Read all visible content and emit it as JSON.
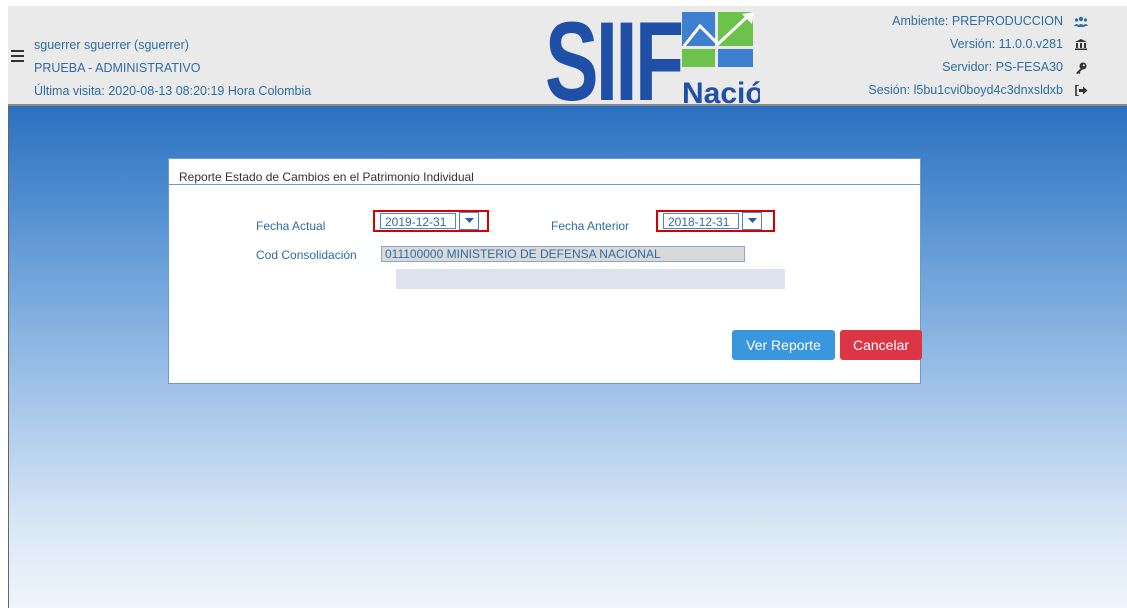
{
  "header": {
    "user_name": "sguerrer sguerrer (sguerrer)",
    "profile": "PRUEBA - ADMINISTRATIVO",
    "last_visit": "Última visita: 2020-08-13 08:20:19 Hora Colombia",
    "logo": {
      "main_text": "SIIF",
      "sub_text": "Nación",
      "brand_color": "#1f4fa6",
      "accent_color": "#6cc24a"
    },
    "environment": "Ambiente: PREPRODUCCION",
    "version": "Versión: 11.0.0.v281",
    "server": "Servidor: PS-FESA30",
    "session": "Sesión: l5bu1cvi0boyd4c3dnxsldxb",
    "icons": [
      "users-icon",
      "bank-icon",
      "key-icon",
      "logout-icon",
      "menu-icon"
    ]
  },
  "panel": {
    "title": "Reporte Estado de Cambios en el Patrimonio Individual",
    "fecha_actual_label": "Fecha Actual",
    "fecha_actual_value": "2019-12-31",
    "fecha_anterior_label": "Fecha Anterior",
    "fecha_anterior_value": "2018-12-31",
    "cod_consolidacion_label": "Cod Consolidación",
    "cod_consolidacion_value": "011100000 MINISTERIO DE DEFENSA NACIONAL",
    "ver_reporte_label": "Ver Reporte",
    "cancelar_label": "Cancelar"
  },
  "colors": {
    "highlight_border": "#d60000",
    "primary_button": "#3a96dd",
    "danger_button": "#dc3545",
    "text_blue": "#2e6da4"
  }
}
